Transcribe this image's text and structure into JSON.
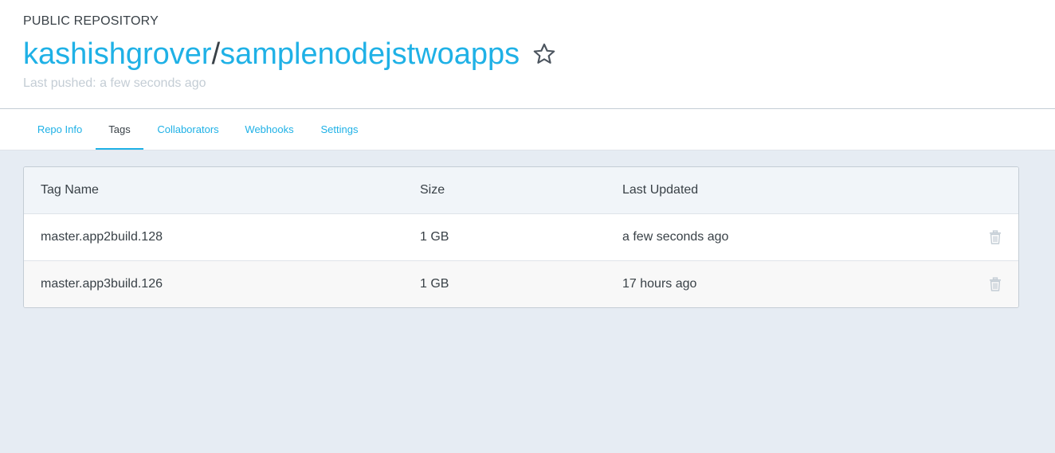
{
  "repo": {
    "visibility": "PUBLIC REPOSITORY",
    "owner": "kashishgrover",
    "separator": "/",
    "name": "samplenodejstwoapps",
    "star_icon": "star-icon",
    "last_pushed": "Last pushed: a few seconds ago"
  },
  "tabs": [
    {
      "label": "Repo Info",
      "active": false
    },
    {
      "label": "Tags",
      "active": true
    },
    {
      "label": "Collaborators",
      "active": false
    },
    {
      "label": "Webhooks",
      "active": false
    },
    {
      "label": "Settings",
      "active": false
    }
  ],
  "table": {
    "headers": [
      "Tag Name",
      "Size",
      "Last Updated"
    ],
    "rows": [
      {
        "tag": "master.app2build.128",
        "size": "1 GB",
        "updated": "a few seconds ago",
        "action_icon": "trash-icon"
      },
      {
        "tag": "master.app3build.126",
        "size": "1 GB",
        "updated": "17 hours ago",
        "action_icon": "trash-icon"
      }
    ]
  },
  "colors": {
    "accent": "#1fb1e6",
    "text": "#394147",
    "muted": "#c4cdd5",
    "background": "#e6ecf3"
  }
}
